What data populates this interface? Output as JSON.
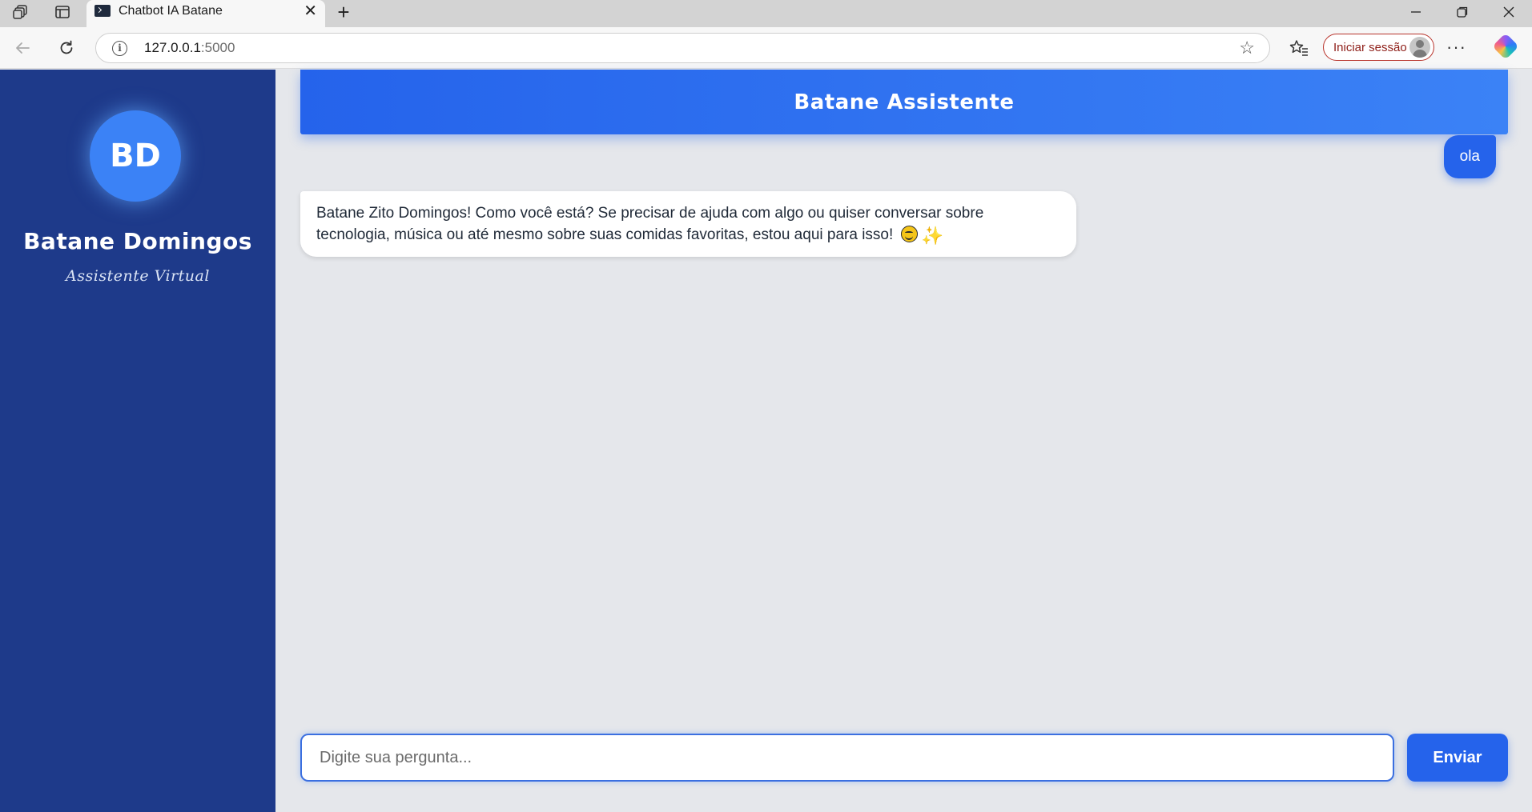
{
  "browser": {
    "tab_title": "Chatbot IA Batane",
    "url_host": "127.0.0.1",
    "url_port": ":5000",
    "signin_label": "Iniciar sessão"
  },
  "sidebar": {
    "avatar_initials": "BD",
    "name": "Batane Domingos",
    "role": "Assistente Virtual"
  },
  "chat": {
    "header_title": "Batane Assistente",
    "messages": [
      {
        "sender": "user",
        "text": "ola"
      },
      {
        "sender": "bot",
        "text": "Batane Zito Domingos! Como você está? Se precisar de ajuda com algo ou quiser conversar sobre tecnologia, música ou até mesmo sobre suas comidas favoritas, estou aqui para isso!"
      }
    ],
    "input_placeholder": "Digite sua pergunta...",
    "send_label": "Enviar"
  },
  "colors": {
    "sidebar_bg": "#1e3a8a",
    "accent": "#2563eb",
    "avatar": "#3b82f6",
    "chat_bg": "#e5e7eb"
  },
  "icons": [
    "collections-icon",
    "tab-actions-icon",
    "terminal-favicon-icon",
    "close-tab-icon",
    "new-tab-icon",
    "minimize-icon",
    "restore-icon",
    "close-window-icon",
    "back-icon",
    "refresh-icon",
    "site-info-icon",
    "favorite-star-icon",
    "favorites-icon",
    "profile-avatar-icon",
    "more-icon",
    "copilot-icon",
    "smile-emoji-icon",
    "sparkle-emoji-icon"
  ]
}
